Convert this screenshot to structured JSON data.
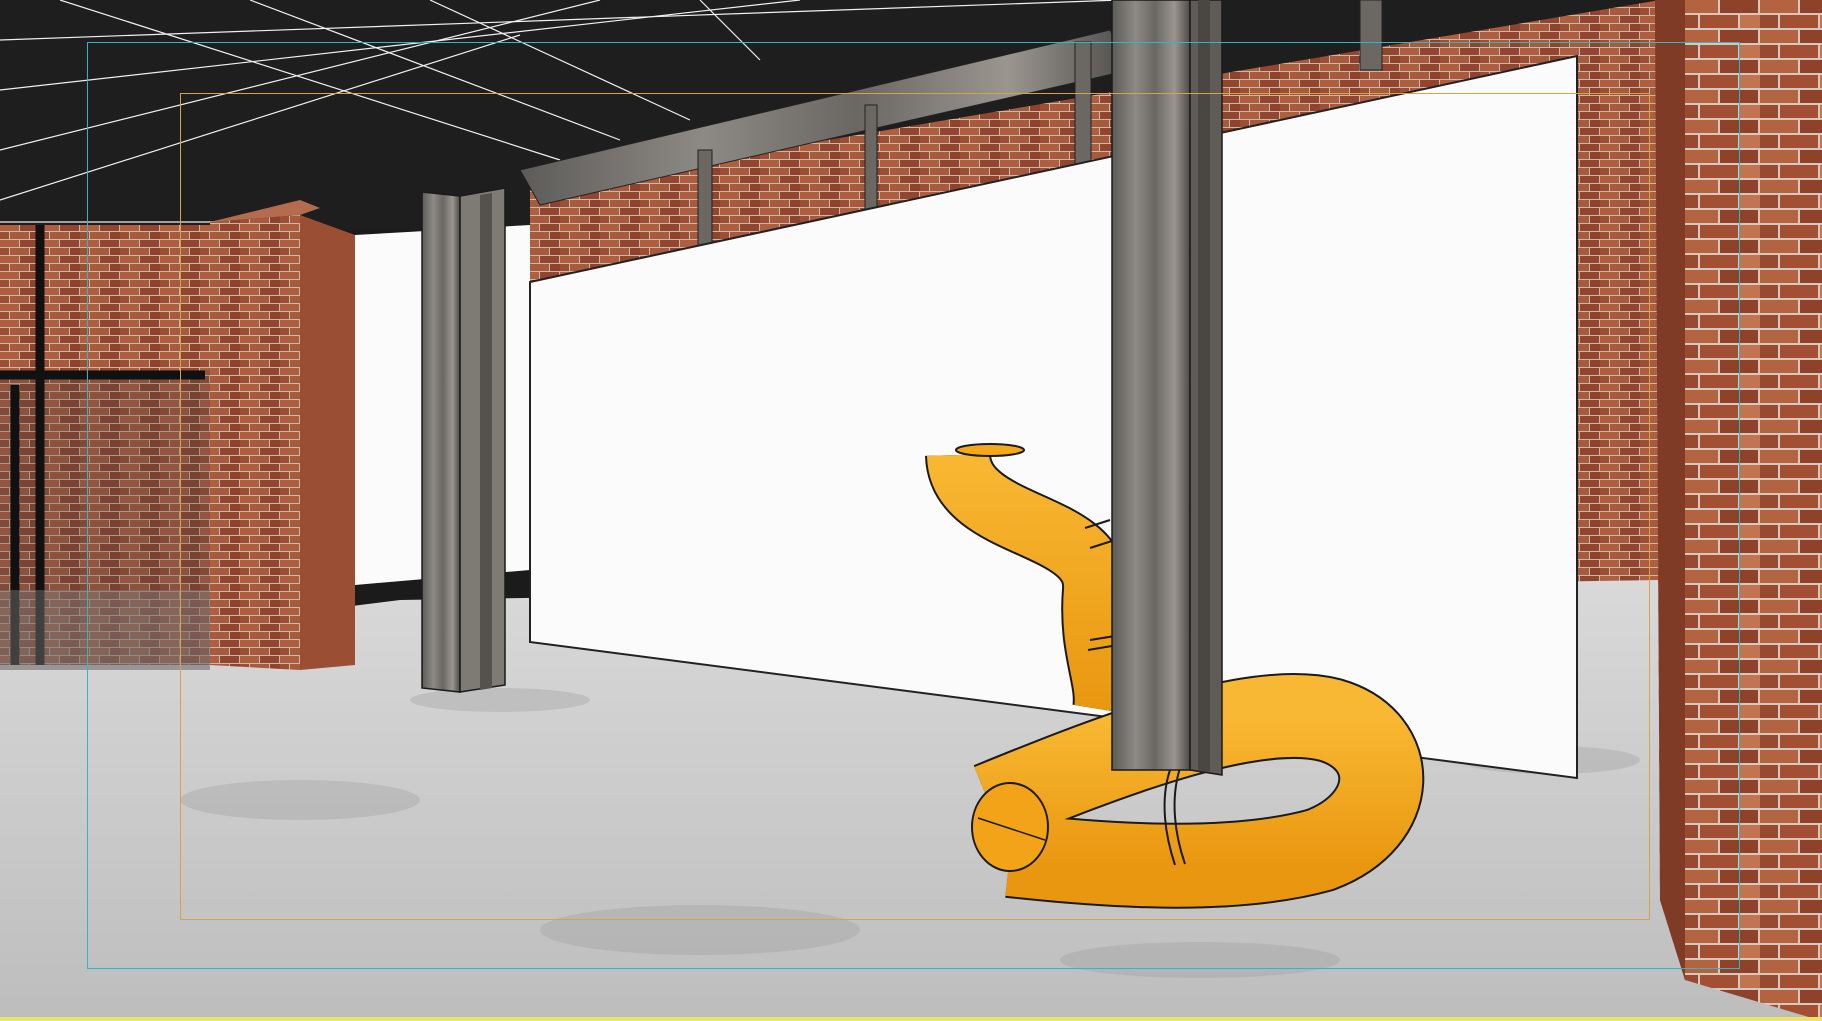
{
  "viewport": {
    "kind": "3D architectural perspective render",
    "materials": [
      "brick-wall",
      "concrete-floor",
      "steel-column",
      "white-partition-wall",
      "black-ceiling-structure",
      "orange-tube-sculpture"
    ]
  },
  "guides": {
    "outer_frame_color": "#2fb7c2",
    "inner_frame_color": "#d6a24e",
    "bottom_line_color": "#e8e46a"
  },
  "colors": {
    "brick": "#9a4f33",
    "concrete": "#cfcfcf",
    "steel": "#6f6d69",
    "wall": "#fbfbfb",
    "ceiling": "#1e1e1e",
    "sculpture": "#f4a81a"
  }
}
